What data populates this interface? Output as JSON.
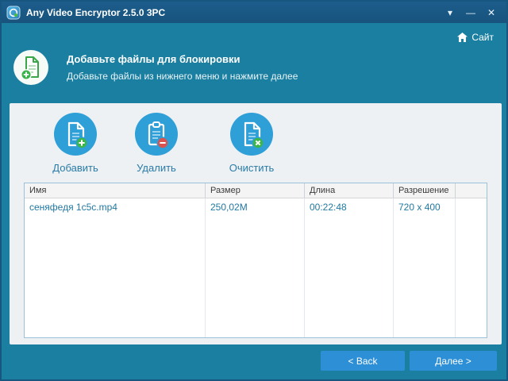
{
  "window": {
    "title": "Any Video Encryptor 2.5.0 3PC",
    "controls": {
      "menu": "▾",
      "minimize": "—",
      "close": "✕"
    }
  },
  "topbar": {
    "site_link": "Сайт"
  },
  "header": {
    "title": "Добавьте файлы для блокировки",
    "subtitle": "Добавьте файлы из нижнего меню и нажмите далее"
  },
  "toolbar": {
    "add_label": "Добавить",
    "delete_label": "Удалить",
    "clear_label": "Очистить"
  },
  "table": {
    "columns": [
      "Имя",
      "Размер",
      "Длина",
      "Разрешение",
      ""
    ],
    "rows": [
      {
        "name": "сеняфедя 1с5с.mp4",
        "size": "250,02M",
        "length": "00:22:48",
        "resolution": "720 x 400"
      }
    ]
  },
  "footer": {
    "back_label": "< Back",
    "next_label": "Далее >"
  },
  "colors": {
    "titlebar": "#17537d",
    "background": "#1a7fa0",
    "panel": "#eef1f4",
    "accent_circle": "#2f9fd7",
    "button_blue": "#2d8fd6",
    "row_text": "#2179a2",
    "green": "#3cb54a",
    "red": "#d9534f"
  }
}
